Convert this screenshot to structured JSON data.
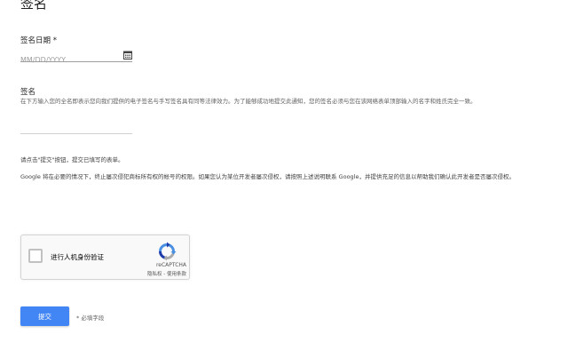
{
  "section": {
    "title": "签名"
  },
  "date": {
    "label": "签名日期 *",
    "placeholder": "MM/DD/YYYY",
    "icon": "calendar-icon"
  },
  "signature": {
    "label": "签名",
    "description": "在下方输入您的全名即表示您向我们提供的电子签名与手写签名具有同等法律效力。为了能够成功地提交此通知，您的签名必须与您在该网络表单顶部输入的名字和姓氏完全一致。"
  },
  "instructions": {
    "submit_note": "请点击\"提交\"按钮，提交已填写的表单。",
    "google_note": "Google 将在必要的情况下，终止屡次侵犯商标所有权的帐号的权限。如果您认为某位开发者屡次侵权，请按照上述说明联系 Google，并提供充足的信息以帮助我们确认此开发者是否屡次侵权。"
  },
  "captcha": {
    "label": "进行人机身份验证",
    "brand": "reCAPTCHA",
    "links": "隐私权 - 使用条款",
    "icon": "recaptcha-logo-icon"
  },
  "form": {
    "submit_label": "提交",
    "required_note": "* 必填字段"
  },
  "colors": {
    "accent": "#4285f4",
    "recaptcha_blue": "#1c3aa9",
    "recaptcha_light_blue": "#4a90e2",
    "recaptcha_gray": "#ababab"
  }
}
